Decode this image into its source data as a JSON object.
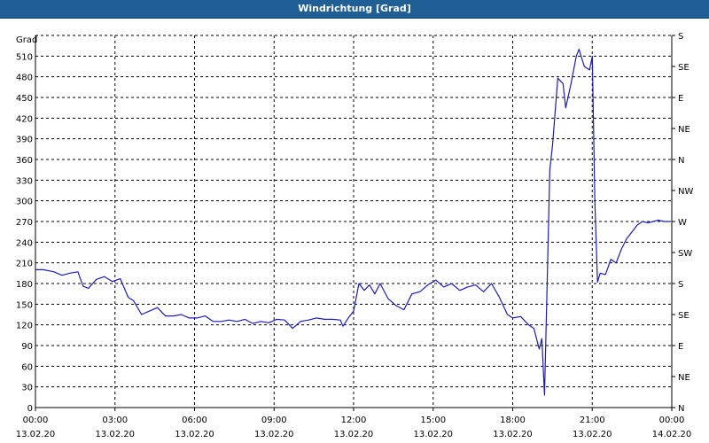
{
  "window": {
    "title": "Windrichtung [Grad]"
  },
  "colors": {
    "titlebar": "#1f5f96",
    "line": "#1c1cb4",
    "grid": "#000000"
  },
  "chart_data": {
    "type": "line",
    "title": "Windrichtung [Grad]",
    "ylabel": "Grad",
    "xlabel": "",
    "xlim": [
      0,
      24
    ],
    "ylim": [
      0,
      540
    ],
    "grid": true,
    "x_ticks": [
      {
        "h": 0,
        "time": "00:00",
        "date": "13.02.20"
      },
      {
        "h": 3,
        "time": "03:00",
        "date": "13.02.20"
      },
      {
        "h": 6,
        "time": "06:00",
        "date": "13.02.20"
      },
      {
        "h": 9,
        "time": "09:00",
        "date": "13.02.20"
      },
      {
        "h": 12,
        "time": "12:00",
        "date": "13.02.20"
      },
      {
        "h": 15,
        "time": "15:00",
        "date": "13.02.20"
      },
      {
        "h": 18,
        "time": "18:00",
        "date": "13.02.20"
      },
      {
        "h": 21,
        "time": "21:00",
        "date": "13.02.20"
      },
      {
        "h": 24,
        "time": "00:00",
        "date": "14.02.20"
      }
    ],
    "y_ticks": [
      0,
      30,
      60,
      90,
      120,
      150,
      180,
      210,
      240,
      270,
      300,
      330,
      360,
      390,
      420,
      450,
      480,
      510
    ],
    "y2_ticks": [
      {
        "v": 0,
        "label": "N"
      },
      {
        "v": 45,
        "label": "NE"
      },
      {
        "v": 90,
        "label": "E"
      },
      {
        "v": 135,
        "label": "SE"
      },
      {
        "v": 180,
        "label": "S"
      },
      {
        "v": 225,
        "label": "SW"
      },
      {
        "v": 270,
        "label": "W"
      },
      {
        "v": 315,
        "label": "NW"
      },
      {
        "v": 360,
        "label": "N"
      },
      {
        "v": 405,
        "label": "NE"
      },
      {
        "v": 450,
        "label": "E"
      },
      {
        "v": 495,
        "label": "SE"
      },
      {
        "v": 540,
        "label": "S"
      }
    ],
    "series": [
      {
        "x": [
          0.0,
          0.3,
          0.7,
          1.0,
          1.3,
          1.6,
          1.8,
          2.0,
          2.3,
          2.6,
          2.9,
          3.2,
          3.5,
          3.7,
          4.0,
          4.3,
          4.6,
          4.9,
          5.2,
          5.5,
          5.8,
          6.1,
          6.4,
          6.7,
          7.0,
          7.3,
          7.6,
          7.9,
          8.2,
          8.5,
          8.8,
          9.1,
          9.4,
          9.7,
          10.0,
          10.3,
          10.6,
          10.9,
          11.2,
          11.5,
          11.6,
          11.8,
          12.0,
          12.2,
          12.4,
          12.6,
          12.8,
          13.0,
          13.3,
          13.6,
          13.9,
          14.2,
          14.5,
          14.8,
          15.1,
          15.4,
          15.7,
          16.0,
          16.3,
          16.6,
          16.9,
          17.2,
          17.5,
          17.8,
          18.0,
          18.3,
          18.6,
          18.8,
          19.0,
          19.1,
          19.2,
          19.4,
          19.5,
          19.7,
          19.9,
          20.0,
          20.2,
          20.4,
          20.5,
          20.7,
          20.9,
          21.0,
          21.1,
          21.2,
          21.3,
          21.5,
          21.7,
          21.9,
          22.1,
          22.3,
          22.5,
          22.7,
          22.9,
          23.1,
          23.3,
          23.5,
          23.7,
          23.9
        ],
        "values": [
          200,
          200,
          197,
          192,
          195,
          197,
          176,
          173,
          186,
          190,
          183,
          187,
          160,
          155,
          135,
          140,
          145,
          133,
          133,
          135,
          130,
          130,
          133,
          125,
          125,
          127,
          125,
          128,
          122,
          125,
          123,
          128,
          127,
          115,
          125,
          127,
          130,
          128,
          128,
          127,
          118,
          130,
          140,
          180,
          170,
          178,
          165,
          180,
          158,
          148,
          142,
          165,
          168,
          178,
          185,
          175,
          180,
          170,
          175,
          178,
          168,
          180,
          160,
          135,
          130,
          132,
          120,
          115,
          85,
          100,
          18,
          345,
          380,
          478,
          470,
          435,
          470,
          510,
          520,
          495,
          490,
          510,
          300,
          182,
          195,
          193,
          215,
          210,
          230,
          245,
          255,
          265,
          270,
          268,
          270,
          272,
          270,
          270
        ]
      }
    ]
  }
}
